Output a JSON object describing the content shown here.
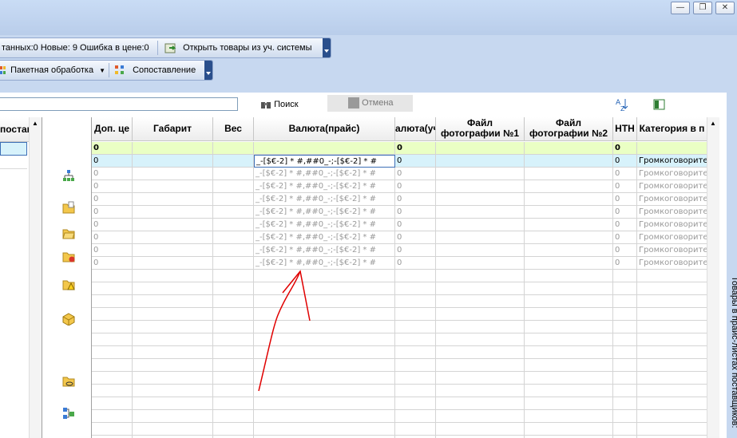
{
  "window": {
    "minimize_glyph": "—",
    "restore_glyph": "❐",
    "close_glyph": "✕"
  },
  "toolbar1": {
    "status_text": "танных:0 Новые: 9 Ошибка в цене:0",
    "open_button": "Открыть товары из уч. системы"
  },
  "toolbar2": {
    "batch_button": "Пакетная обработка",
    "match_button": "Сопоставление"
  },
  "search": {
    "value": "",
    "search_button": "Поиск",
    "cancel_button": "Отмена"
  },
  "left_pane": {
    "header": "постав"
  },
  "grid": {
    "columns": [
      {
        "line1": "Доп. це",
        "line2": ""
      },
      {
        "line1": "Габарит",
        "line2": ""
      },
      {
        "line1": "Вес",
        "line2": ""
      },
      {
        "line1": "Валюта(прайс)",
        "line2": ""
      },
      {
        "line1": "алюта(учс",
        "line2": ""
      },
      {
        "line1": "Файл",
        "line2": "фотографии №1"
      },
      {
        "line1": "Файл",
        "line2": "фотографии №2"
      },
      {
        "line1": "НТН",
        "line2": ""
      },
      {
        "line1": "Категория в п",
        "line2": ""
      }
    ],
    "total_row": [
      "0",
      "",
      "",
      "",
      "0",
      "",
      "",
      "0",
      ""
    ],
    "rows": [
      [
        "0",
        "",
        "",
        "_-[$€-2] * #,##0_-;-[$€-2] * #",
        "0",
        "",
        "",
        "0",
        "Громкоговорител"
      ],
      [
        "0",
        "",
        "",
        "_-[$€-2] * #,##0_-;-[$€-2] * #",
        "0",
        "",
        "",
        "0",
        "Громкоговорител"
      ],
      [
        "0",
        "",
        "",
        "_-[$€-2] * #,##0_-;-[$€-2] * #",
        "0",
        "",
        "",
        "0",
        "Громкоговорител"
      ],
      [
        "0",
        "",
        "",
        "_-[$€-2] * #,##0_-;-[$€-2] * #",
        "0",
        "",
        "",
        "0",
        "Громкоговорител"
      ],
      [
        "0",
        "",
        "",
        "_-[$€-2] * #,##0_-;-[$€-2] * #",
        "0",
        "",
        "",
        "0",
        "Громкоговорител"
      ],
      [
        "0",
        "",
        "",
        "_-[$€-2] * #,##0_-;-[$€-2] * #",
        "0",
        "",
        "",
        "0",
        "Громкоговорител"
      ],
      [
        "0",
        "",
        "",
        "_-[$€-2] * #,##0_-;-[$€-2] * #",
        "0",
        "",
        "",
        "0",
        "Громкоговорител"
      ],
      [
        "0",
        "",
        "",
        "_-[$€-2] * #,##0_-;-[$€-2] * #",
        "0",
        "",
        "",
        "0",
        "Громкоговорител"
      ],
      [
        "0",
        "",
        "",
        "_-[$€-2] * #,##0_-;-[$€-2] * #",
        "0",
        "",
        "",
        "0",
        "Громкоговорител"
      ]
    ],
    "selected_row_index": 0,
    "focused_column_index": 3
  },
  "side_panel": {
    "label": "Товары в прайс-листах поставщиков:"
  },
  "colors": {
    "accent": "#2a4f8c",
    "total_row": "#eaffc4",
    "selected_row": "#d7f2fb",
    "annotation": "#e00000"
  }
}
